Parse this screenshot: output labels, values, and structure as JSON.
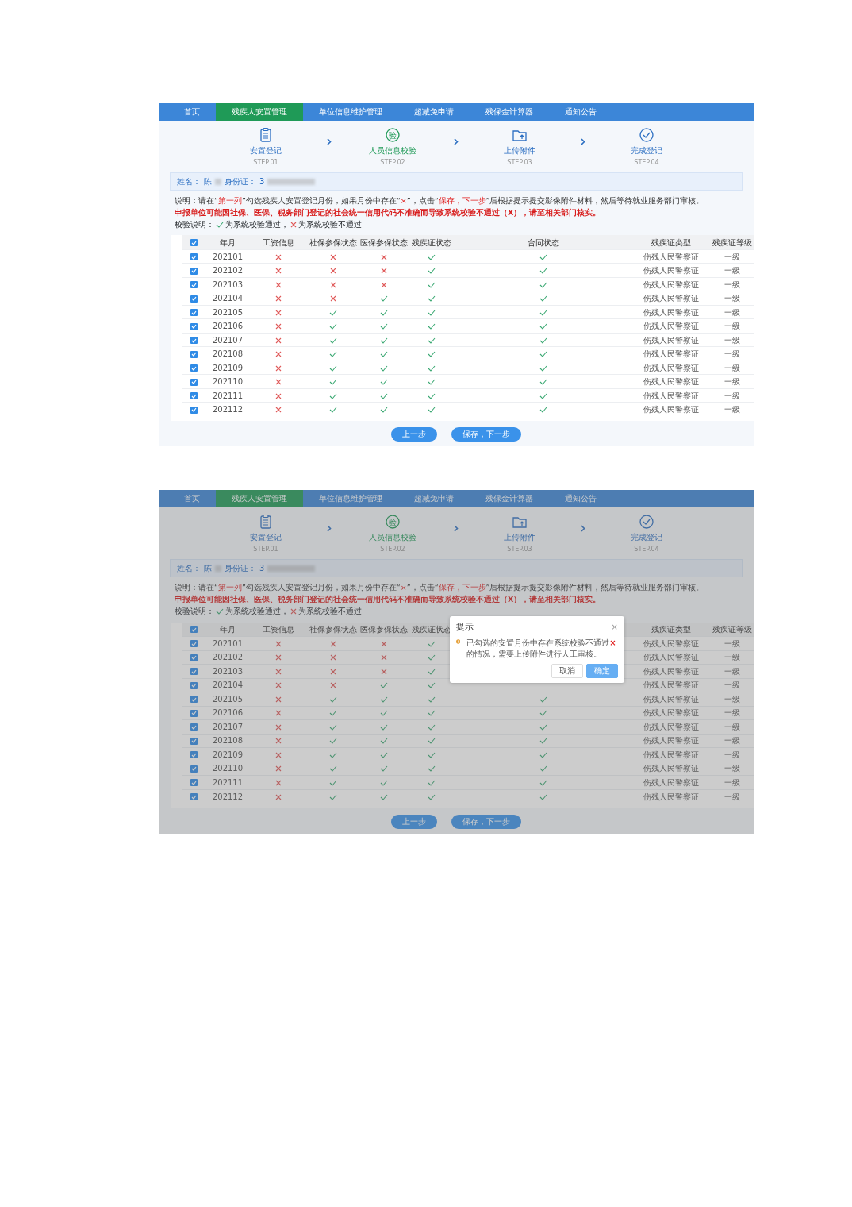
{
  "screens": [
    {
      "nav": [
        {
          "label": "首页",
          "selected": false
        },
        {
          "label": "残疾人安置管理",
          "selected": true
        },
        {
          "label": "单位信息维护管理",
          "selected": false
        },
        {
          "label": "超减免申请",
          "selected": false
        },
        {
          "label": "残保金计算器",
          "selected": false
        },
        {
          "label": "通知公告",
          "selected": false
        }
      ],
      "steps": [
        {
          "kind": "clipboard",
          "title": "安置登记",
          "step": "STEP.01",
          "selected": false
        },
        {
          "kind": "seal",
          "badge": "验",
          "title": "人员信息校验",
          "step": "STEP.02",
          "selected": true
        },
        {
          "kind": "folder",
          "title": "上传附件",
          "step": "STEP.03",
          "selected": false
        },
        {
          "kind": "check",
          "title": "完成登记",
          "step": "STEP.04",
          "selected": false
        }
      ],
      "person": {
        "name_label": "姓名：",
        "name": "陈",
        "id_label": "身份证：",
        "id": "3"
      },
      "notes": [
        {
          "kind": "info",
          "text": "说明：请在“**第一列**”勾选残疾人安置登记月份，如果月份中存在“**×**”，点击“**保存，下一步**”后根据提示提交影像附件材料，然后等待就业服务部门审核。"
        },
        {
          "kind": "warning",
          "text": "申报单位可能因社保、医保、税务部门登记的社会统一信用代码不准确而导致系统校验不通过（X），请至相关部门核实。"
        }
      ],
      "legend": {
        "label": "校验说明：",
        "items": [
          {
            "passed": true,
            "text": "为系统校验通过，"
          },
          {
            "passed": false,
            "text": "为系统校验不通过"
          }
        ]
      },
      "table": {
        "all_checked": true,
        "columns": [
          "年月",
          "工资信息",
          "社保参保状态",
          "医保参保状态",
          "残疾证状态"
        ],
        "contract_header": "合同状态",
        "columns_right": [
          "残疾证类型",
          "残疾证等级"
        ],
        "rows": [
          {
            "checked": true,
            "month": "202101",
            "checks": [
              false,
              false,
              false,
              true
            ],
            "contract": true,
            "type": "伤残人民警察证",
            "grade": "一级"
          },
          {
            "checked": true,
            "month": "202102",
            "checks": [
              false,
              false,
              false,
              true
            ],
            "contract": true,
            "type": "伤残人民警察证",
            "grade": "一级"
          },
          {
            "checked": true,
            "month": "202103",
            "checks": [
              false,
              false,
              false,
              true
            ],
            "contract": true,
            "type": "伤残人民警察证",
            "grade": "一级"
          },
          {
            "checked": true,
            "month": "202104",
            "checks": [
              false,
              false,
              true,
              true
            ],
            "contract": true,
            "type": "伤残人民警察证",
            "grade": "一级"
          },
          {
            "checked": true,
            "month": "202105",
            "checks": [
              false,
              true,
              true,
              true
            ],
            "contract": true,
            "type": "伤残人民警察证",
            "grade": "一级"
          },
          {
            "checked": true,
            "month": "202106",
            "checks": [
              false,
              true,
              true,
              true
            ],
            "contract": true,
            "type": "伤残人民警察证",
            "grade": "一级"
          },
          {
            "checked": true,
            "month": "202107",
            "checks": [
              false,
              true,
              true,
              true
            ],
            "contract": true,
            "type": "伤残人民警察证",
            "grade": "一级"
          },
          {
            "checked": true,
            "month": "202108",
            "checks": [
              false,
              true,
              true,
              true
            ],
            "contract": true,
            "type": "伤残人民警察证",
            "grade": "一级"
          },
          {
            "checked": true,
            "month": "202109",
            "checks": [
              false,
              true,
              true,
              true
            ],
            "contract": true,
            "type": "伤残人民警察证",
            "grade": "一级"
          },
          {
            "checked": true,
            "month": "202110",
            "checks": [
              false,
              true,
              true,
              true
            ],
            "contract": true,
            "type": "伤残人民警察证",
            "grade": "一级"
          },
          {
            "checked": true,
            "month": "202111",
            "checks": [
              false,
              true,
              true,
              true
            ],
            "contract": true,
            "type": "伤残人民警察证",
            "grade": "一级"
          },
          {
            "checked": true,
            "month": "202112",
            "checks": [
              false,
              true,
              true,
              true
            ],
            "contract": true,
            "type": "伤残人民警察证",
            "grade": "一级"
          }
        ]
      },
      "buttons": [
        "上一步",
        "保存，下一步"
      ]
    },
    {
      "nav": [
        {
          "label": "首页",
          "selected": false
        },
        {
          "label": "残疾人安置管理",
          "selected": true
        },
        {
          "label": "单位信息维护管理",
          "selected": false
        },
        {
          "label": "超减免申请",
          "selected": false
        },
        {
          "label": "残保金计算器",
          "selected": false
        },
        {
          "label": "通知公告",
          "selected": false
        }
      ],
      "steps": [
        {
          "kind": "clipboard",
          "title": "安置登记",
          "step": "STEP.01",
          "selected": false
        },
        {
          "kind": "seal",
          "badge": "验",
          "title": "人员信息校验",
          "step": "STEP.02",
          "selected": true
        },
        {
          "kind": "folder",
          "title": "上传附件",
          "step": "STEP.03",
          "selected": false
        },
        {
          "kind": "check",
          "title": "完成登记",
          "step": "STEP.04",
          "selected": false
        }
      ],
      "person": {
        "name_label": "姓名：",
        "name": "陈",
        "id_label": "身份证：",
        "id": "3"
      },
      "notes": [
        {
          "kind": "info",
          "text": "说明：请在“**第一列**”勾选残疾人安置登记月份，如果月份中存在“**×**”，点击“**保存，下一步**”后根据提示提交影像附件材料，然后等待就业服务部门审核。"
        },
        {
          "kind": "warning",
          "text": "申报单位可能因社保、医保、税务部门登记的社会统一信用代码不准确而导致系统校验不通过（X），请至相关部门核实。"
        }
      ],
      "legend": {
        "label": "校验说明：",
        "items": [
          {
            "passed": true,
            "text": "为系统校验通过，"
          },
          {
            "passed": false,
            "text": "为系统校验不通过"
          }
        ]
      },
      "table": {
        "all_checked": true,
        "columns": [
          "年月",
          "工资信息",
          "社保参保状态",
          "医保参保状态",
          "残疾证状态"
        ],
        "columns_right": [
          "残疾证类型",
          "残疾证等级"
        ],
        "rows": [
          {
            "checked": true,
            "month": "202101",
            "checks": [
              false,
              false,
              false,
              true
            ],
            "type": "伤残人民警察证",
            "grade": "一级"
          },
          {
            "checked": true,
            "month": "202102",
            "checks": [
              false,
              false,
              false,
              true
            ],
            "type": "伤残人民警察证",
            "grade": "一级"
          },
          {
            "checked": true,
            "month": "202103",
            "checks": [
              false,
              false,
              false,
              true
            ],
            "type": "伤残人民警察证",
            "grade": "一级"
          },
          {
            "checked": true,
            "month": "202104",
            "checks": [
              false,
              false,
              true,
              true
            ],
            "type": "伤残人民警察证",
            "grade": "一级"
          },
          {
            "checked": true,
            "month": "202105",
            "checks": [
              false,
              true,
              true,
              true
            ],
            "contract": true,
            "type": "伤残人民警察证",
            "grade": "一级"
          },
          {
            "checked": true,
            "month": "202106",
            "checks": [
              false,
              true,
              true,
              true
            ],
            "contract": true,
            "type": "伤残人民警察证",
            "grade": "一级"
          },
          {
            "checked": true,
            "month": "202107",
            "checks": [
              false,
              true,
              true,
              true
            ],
            "contract": true,
            "type": "伤残人民警察证",
            "grade": "一级"
          },
          {
            "checked": true,
            "month": "202108",
            "checks": [
              false,
              true,
              true,
              true
            ],
            "contract": true,
            "type": "伤残人民警察证",
            "grade": "一级"
          },
          {
            "checked": true,
            "month": "202109",
            "checks": [
              false,
              true,
              true,
              true
            ],
            "contract": true,
            "type": "伤残人民警察证",
            "grade": "一级"
          },
          {
            "checked": true,
            "month": "202110",
            "checks": [
              false,
              true,
              true,
              true
            ],
            "contract": true,
            "type": "伤残人民警察证",
            "grade": "一级"
          },
          {
            "checked": true,
            "month": "202111",
            "checks": [
              false,
              true,
              true,
              true
            ],
            "contract": true,
            "type": "伤残人民警察证",
            "grade": "一级"
          },
          {
            "checked": true,
            "month": "202112",
            "checks": [
              false,
              true,
              true,
              true
            ],
            "contract": true,
            "type": "伤残人民警察证",
            "grade": "一级"
          }
        ]
      },
      "buttons": [
        "上一步",
        "保存，下一步"
      ],
      "dialog": {
        "title": "提示",
        "message": "已勾选的安置月份中存在系统校验不通过**×**的情况，需要上传附件进行人工审核。",
        "close": "×",
        "buttons": [
          "取消",
          "确定"
        ]
      }
    }
  ]
}
